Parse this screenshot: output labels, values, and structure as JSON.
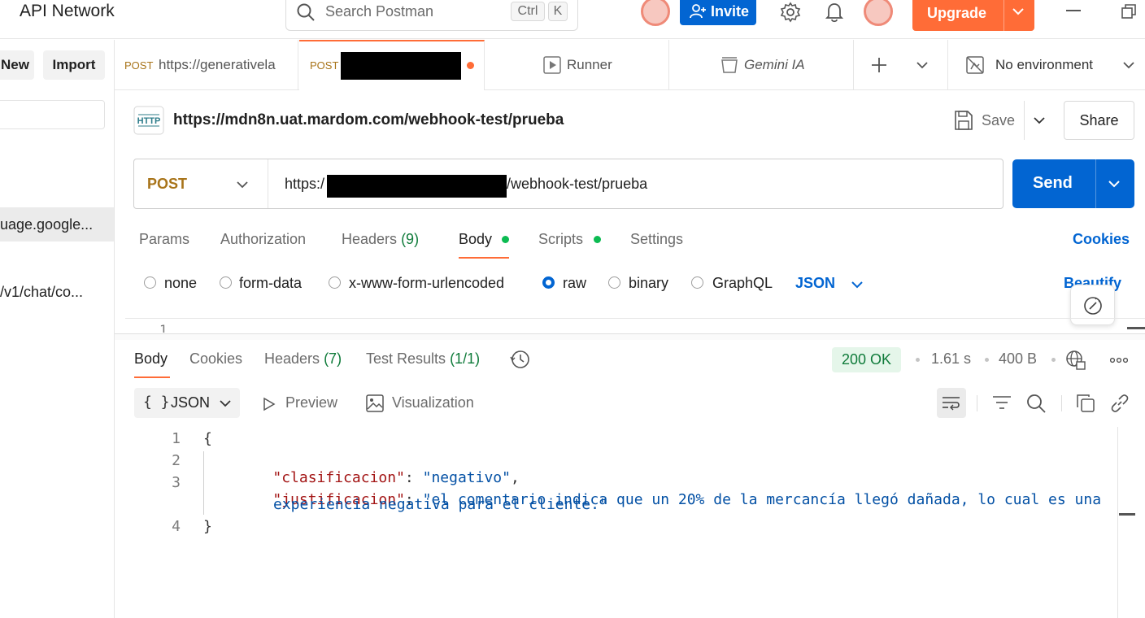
{
  "app": {
    "workspace_title": "API Network",
    "search_placeholder": "Search Postman",
    "search_shortcut": [
      "Ctrl",
      "K"
    ],
    "invite_label": "Invite",
    "upgrade_label": "Upgrade"
  },
  "sidebar": {
    "new_label": "New",
    "import_label": "Import",
    "items": [
      {
        "label": "uage.google..."
      },
      {
        "label": "/v1/chat/co..."
      }
    ]
  },
  "tabs": [
    {
      "method": "POST",
      "label": "https://generativela"
    },
    {
      "method": "POST",
      "label": "",
      "unsaved": true
    },
    {
      "label": "Runner"
    },
    {
      "label": "Gemini IA"
    }
  ],
  "environment": {
    "label": "No environment"
  },
  "request": {
    "name": "https://mdn8n.uat.mardom.com/webhook-test/prueba",
    "method": "POST",
    "url_prefix": "https:/",
    "url_suffix": "/webhook-test/prueba",
    "save_label": "Save",
    "share_label": "Share",
    "send_label": "Send",
    "subtabs": {
      "params": "Params",
      "authorization": "Authorization",
      "headers": "Headers",
      "headers_count": "(9)",
      "body": "Body",
      "scripts": "Scripts",
      "settings": "Settings"
    },
    "cookies_label": "Cookies",
    "body_types": [
      "none",
      "form-data",
      "x-www-form-urlencoded",
      "raw",
      "binary",
      "GraphQL"
    ],
    "body_selected": "raw",
    "body_language": "JSON",
    "beautify_label": "Beautify",
    "editor_line": "1"
  },
  "response": {
    "tabs": {
      "body": "Body",
      "cookies": "Cookies",
      "headers": "Headers",
      "headers_count": "(7)",
      "tests": "Test Results",
      "tests_count": "(1/1)"
    },
    "status": "200 OK",
    "time": "1.61 s",
    "size": "400 B",
    "format": "JSON",
    "preview_label": "Preview",
    "visualization_label": "Visualization",
    "lines": {
      "n1": "1",
      "n2": "2",
      "n3": "3",
      "n4": "4",
      "open": "{",
      "key1": "\"clasificacion\"",
      "val1": "\"negativo\"",
      "key2": "\"justificacion\"",
      "val2a": "\"el comentario indica que un 20% de la mercancía llegó dañada, lo cual es una",
      "val2b": "experiencia negativa para el cliente.\"",
      "close": "}"
    }
  },
  "colors": {
    "primary": "#0265d2",
    "upgrade": "#ff6c37",
    "post_method": "#a8741a",
    "status_ok": "#0f7b3a",
    "status_bg": "#e5f6ea",
    "json_key": "#a31515",
    "json_string": "#0451a5",
    "active_underline": "#ff6c37"
  }
}
